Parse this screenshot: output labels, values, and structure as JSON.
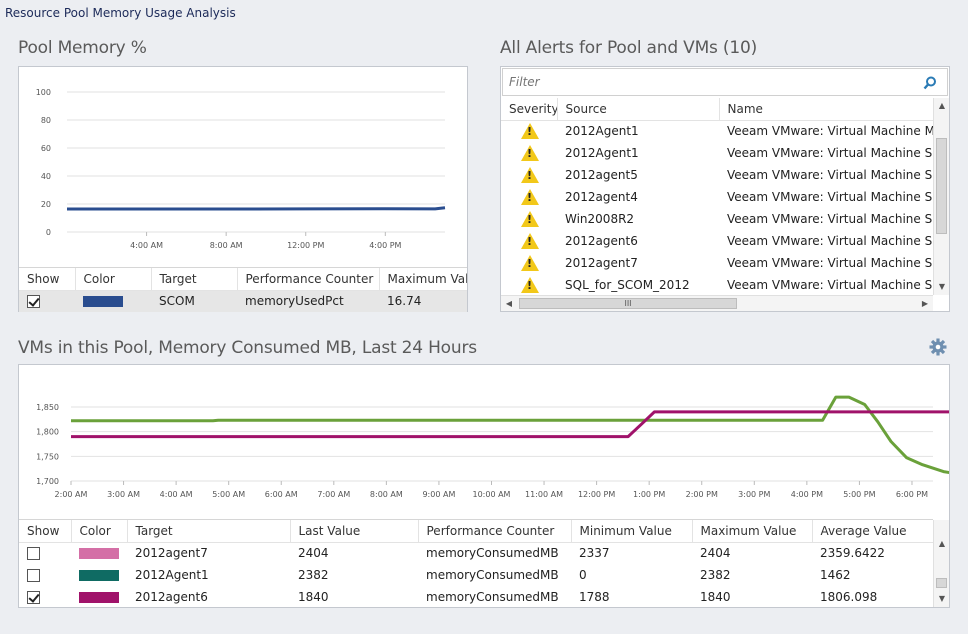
{
  "page": {
    "title": "Resource Pool Memory Usage Analysis"
  },
  "pool_memory": {
    "title": "Pool Memory %",
    "columns": [
      "Show",
      "Color",
      "Target",
      "Performance Counter",
      "Maximum Value"
    ],
    "rows": [
      {
        "show": true,
        "color": "#2a4d8f",
        "target": "SCOM",
        "counter": "memoryUsedPct",
        "max": "16.74"
      }
    ]
  },
  "alerts": {
    "title": "All Alerts for Pool and VMs (10)",
    "filter_placeholder": "Filter",
    "columns": [
      "Severity",
      "Source",
      "Name"
    ],
    "rows": [
      {
        "severity": "warning",
        "source": "2012Agent1",
        "name": "Veeam VMware: Virtual Machine Memo"
      },
      {
        "severity": "warning",
        "source": "2012Agent1",
        "name": "Veeam VMware: Virtual Machine Snaps"
      },
      {
        "severity": "warning",
        "source": "2012agent5",
        "name": "Veeam VMware: Virtual Machine Snaps"
      },
      {
        "severity": "warning",
        "source": "2012agent4",
        "name": "Veeam VMware: Virtual Machine Snaps"
      },
      {
        "severity": "warning",
        "source": "Win2008R2",
        "name": "Veeam VMware: Virtual Machine Snaps"
      },
      {
        "severity": "warning",
        "source": "2012agent6",
        "name": "Veeam VMware: Virtual Machine Snaps"
      },
      {
        "severity": "warning",
        "source": "2012agent7",
        "name": "Veeam VMware: Virtual Machine Snaps"
      },
      {
        "severity": "warning",
        "source": "SQL_for_SCOM_2012",
        "name": "Veeam VMware: Virtual Machine Snaps"
      }
    ],
    "hscroll_grip": "III"
  },
  "vms": {
    "title": "VMs in this Pool, Memory Consumed MB, Last 24 Hours",
    "columns": [
      "Show",
      "Color",
      "Target",
      "Last Value",
      "Performance Counter",
      "Minimum Value",
      "Maximum Value",
      "Average Value"
    ],
    "rows": [
      {
        "show": false,
        "color": "#d46fa6",
        "target": "2012agent7",
        "last": "2404",
        "counter": "memoryConsumedMB",
        "min": "2337",
        "max": "2404",
        "avg": "2359.6422"
      },
      {
        "show": false,
        "color": "#0f6b63",
        "target": "2012Agent1",
        "last": "2382",
        "counter": "memoryConsumedMB",
        "min": "0",
        "max": "2382",
        "avg": "1462"
      },
      {
        "show": true,
        "color": "#a0126a",
        "target": "2012agent6",
        "last": "1840",
        "counter": "memoryConsumedMB",
        "min": "1788",
        "max": "1840",
        "avg": "1806.098"
      }
    ]
  },
  "chart_data": [
    {
      "type": "line",
      "yticks": [
        "100",
        "80",
        "60",
        "40",
        "20",
        "0"
      ],
      "ylim": [
        0,
        100
      ],
      "xticks": [
        "4:00 AM",
        "8:00 AM",
        "12:00 PM",
        "4:00 PM"
      ],
      "series": [
        {
          "color": "#2a4d8f",
          "x": [
            0,
            4,
            8,
            12,
            16,
            18.5,
            19
          ],
          "values": [
            16.4,
            16.4,
            16.4,
            16.5,
            16.6,
            16.5,
            17.3
          ]
        }
      ]
    },
    {
      "type": "line",
      "yticks": [
        "1,850",
        "1,800",
        "1,750",
        "1,700"
      ],
      "ylim": [
        1700,
        1850
      ],
      "xticks": [
        "2:00 AM",
        "3:00 AM",
        "4:00 AM",
        "5:00 AM",
        "6:00 AM",
        "7:00 AM",
        "8:00 AM",
        "9:00 AM",
        "10:00 AM",
        "11:00 AM",
        "12:00 PM",
        "1:00 PM",
        "2:00 PM",
        "3:00 PM",
        "4:00 PM",
        "5:00 PM",
        "6:00 PM"
      ],
      "series": [
        {
          "color": "#6aa13a",
          "x": [
            0,
            2.7,
            2.8,
            14.3,
            14.55,
            14.8,
            15.1,
            15.35,
            15.6,
            15.9,
            16.2,
            16.6,
            17.0,
            17.5,
            18.0
          ],
          "values": [
            1822,
            1822,
            1823,
            1823,
            1870,
            1870,
            1855,
            1820,
            1780,
            1747,
            1733,
            1719,
            1712,
            1708,
            1706
          ]
        },
        {
          "color": "#a0126a",
          "x": [
            0,
            10.6,
            10.85,
            11.1,
            12.0,
            18.0
          ],
          "values": [
            1790,
            1790,
            1815,
            1840,
            1840,
            1840
          ]
        }
      ]
    }
  ]
}
